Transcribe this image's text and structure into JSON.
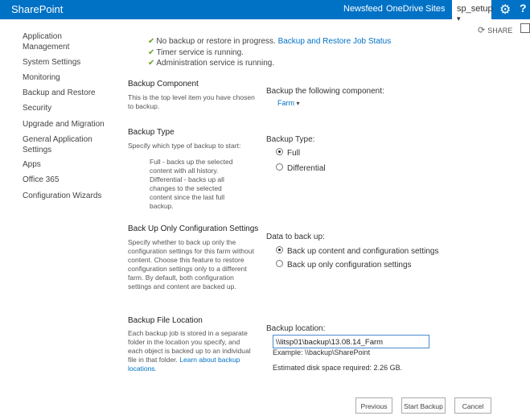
{
  "topbar": {
    "brand": "SharePoint",
    "nav": [
      "Newsfeed",
      "OneDrive",
      "Sites"
    ],
    "user": "sp_setup",
    "user_chevron": "▾"
  },
  "share": {
    "label": "SHARE"
  },
  "sidebar": {
    "items": [
      {
        "label": "Application Management"
      },
      {
        "label": "System Settings"
      },
      {
        "label": "Monitoring"
      },
      {
        "label": "Backup and Restore"
      },
      {
        "label": "Security"
      },
      {
        "label": "Upgrade and Migration"
      },
      {
        "label": "General Application Settings"
      },
      {
        "label": "Apps"
      },
      {
        "label": "Office 365"
      },
      {
        "label": "Configuration Wizards"
      }
    ]
  },
  "status": {
    "line1_text": "No backup or restore in progress. ",
    "line1_link": "Backup and Restore Job Status",
    "line2": "Timer service is running.",
    "line3": "Administration service is running."
  },
  "component": {
    "heading": "Backup Component",
    "desc": "This is the top level item you have chosen to backup.",
    "label": "Backup the following component:",
    "value": "Farm",
    "chevron": "▾"
  },
  "type": {
    "heading": "Backup Type",
    "desc": "Specify which type of backup to start:",
    "detail": "Full - backs up the selected content with all history. Differential - backs up all changes to the selected content since the last full backup.",
    "label": "Backup Type:",
    "options": [
      "Full",
      "Differential"
    ],
    "selected": "Full"
  },
  "config": {
    "heading": "Back Up Only Configuration Settings",
    "desc": "Specify whether to back up only the configuration settings for this farm without content. Choose this feature to restore configuration settings only to a different farm. By default, both configuration settings and content are backed up.",
    "label": "Data to back up:",
    "options": [
      "Back up content and configuration settings",
      "Back up only configuration settings"
    ],
    "selected": "Back up content and configuration settings"
  },
  "location": {
    "heading": "Backup File Location",
    "desc": "Each backup job is stored in a separate folder in the location you specify, and each object is backed up to an individual file in that folder. ",
    "link": "Learn about backup locations.",
    "label": "Backup location:",
    "value": "\\\\litsp01\\backup\\13.08.14_Farm",
    "example": "Example: \\\\backup\\SharePoint",
    "estimate": "Estimated disk space required: 2.26 GB."
  },
  "buttons": {
    "previous": "Previous",
    "start": "Start Backup",
    "cancel": "Cancel"
  },
  "colors": {
    "accent": "#0072c6",
    "check": "#6aa121"
  }
}
